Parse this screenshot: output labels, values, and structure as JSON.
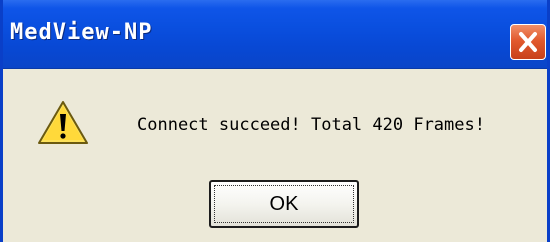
{
  "window": {
    "title": "MedView-NP",
    "close_icon": "close-icon",
    "title_bar_color": "#0a4fdf",
    "close_button_color": "#e25a2e",
    "body_color": "#ece9d8"
  },
  "dialog": {
    "icon": "warning-icon",
    "message": "Connect succeed! Total 420 Frames!",
    "ok_label": "OK"
  }
}
